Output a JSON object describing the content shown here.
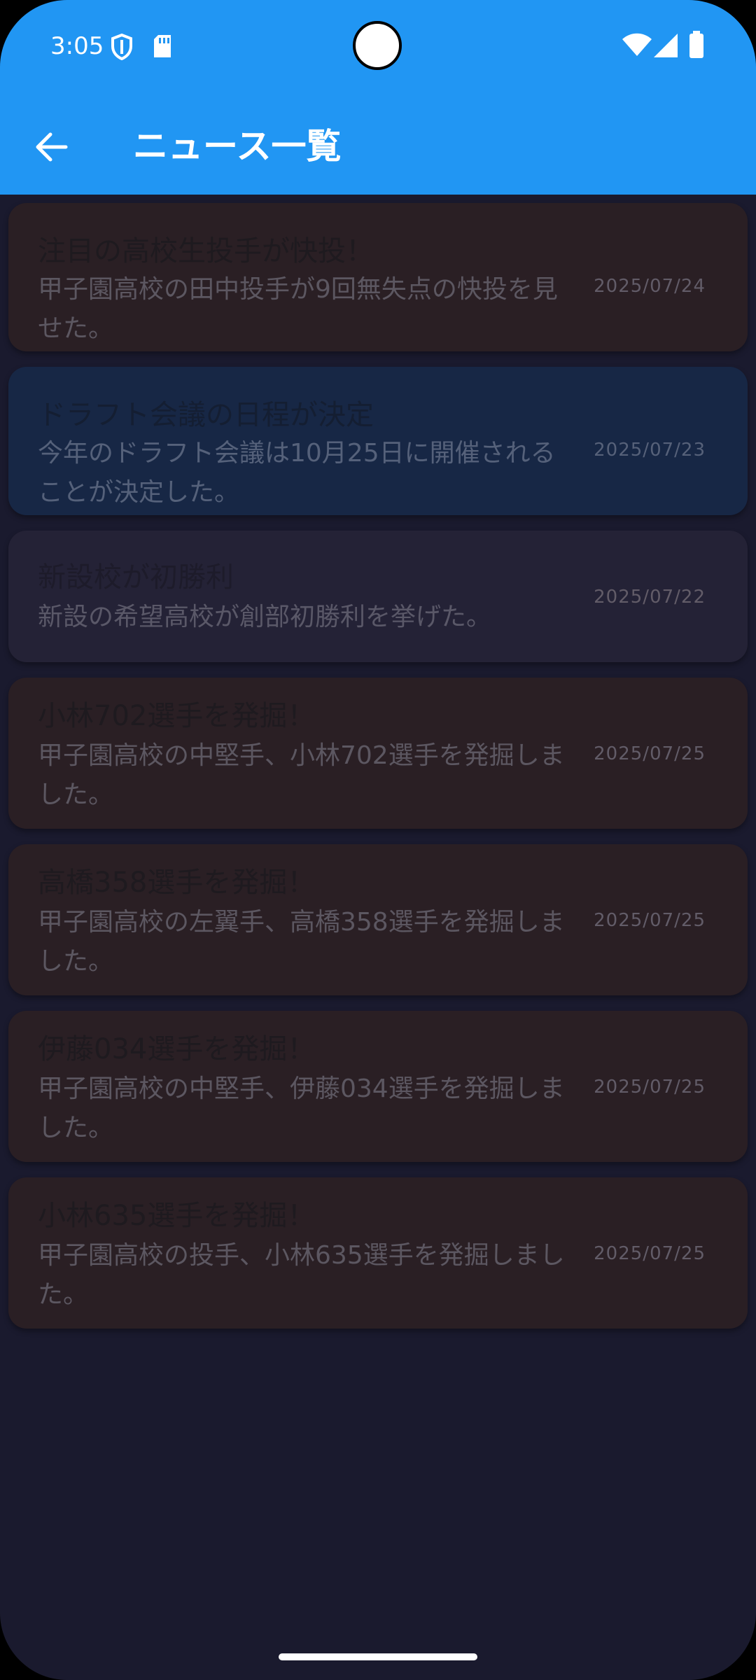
{
  "status_bar": {
    "time": "3:05"
  },
  "app_bar": {
    "title": "ニュース一覧"
  },
  "colors": {
    "app_bar": "#2196f3",
    "background": "#1a1a2e",
    "card_brown": "#2a1f24",
    "card_blue": "#172745",
    "card_gray": "#242236"
  },
  "news": [
    {
      "title": "注目の高校生投手が快投！",
      "description": "甲子園高校の田中投手が9回無失点の快投を見せた。",
      "date": "2025/07/24"
    },
    {
      "title": "ドラフト会議の日程が決定",
      "description": "今年のドラフト会議は10月25日に開催されることが決定した。",
      "date": "2025/07/23"
    },
    {
      "title": "新設校が初勝利",
      "description": "新設の希望高校が創部初勝利を挙げた。",
      "date": "2025/07/22"
    },
    {
      "title": "小林702選手を発掘！",
      "description": "甲子園高校の中堅手、小林702選手を発掘しました。",
      "date": "2025/07/25"
    },
    {
      "title": "高橋358選手を発掘！",
      "description": "甲子園高校の左翼手、高橋358選手を発掘しました。",
      "date": "2025/07/25"
    },
    {
      "title": "伊藤034選手を発掘！",
      "description": "甲子園高校の中堅手、伊藤034選手を発掘しました。",
      "date": "2025/07/25"
    },
    {
      "title": "小林635選手を発掘！",
      "description": "甲子園高校の投手、小林635選手を発掘しました。",
      "date": "2025/07/25"
    }
  ]
}
